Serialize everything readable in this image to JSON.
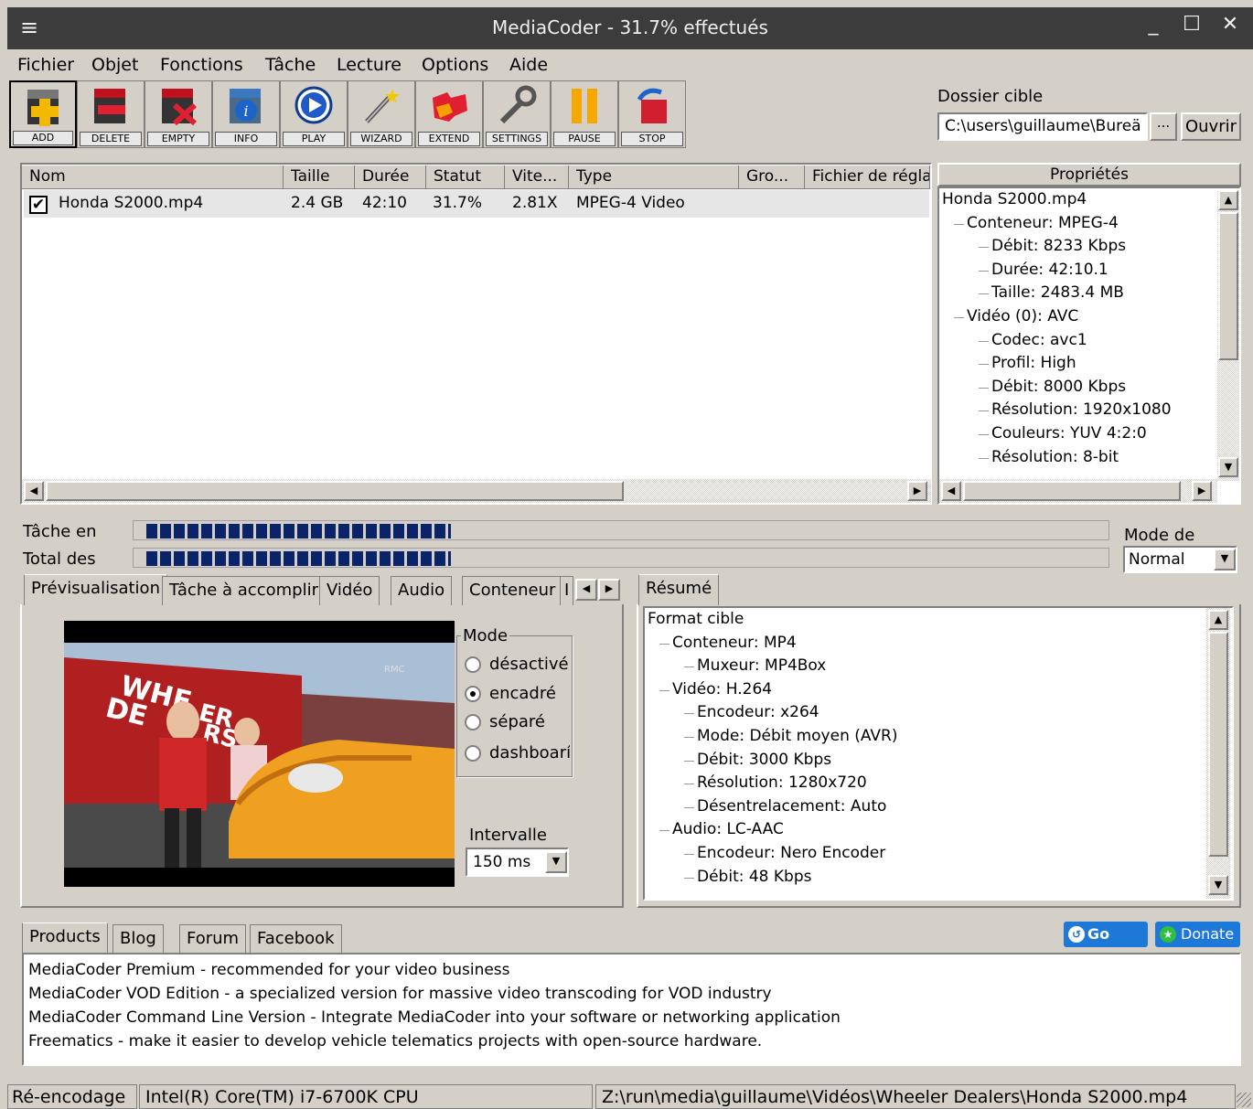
{
  "window": {
    "title": "MediaCoder - 31.7% effectués"
  },
  "menu": [
    "Fichier",
    "Objet",
    "Fonctions",
    "Tâche",
    "Lecture",
    "Options",
    "Aide"
  ],
  "toolbar": [
    {
      "label": "ADD",
      "icon": "add-icon"
    },
    {
      "label": "DELETE",
      "icon": "delete-icon"
    },
    {
      "label": "EMPTY",
      "icon": "empty-icon"
    },
    {
      "label": "INFO",
      "icon": "info-icon"
    },
    {
      "label": "PLAY",
      "icon": "play-icon"
    },
    {
      "label": "WIZARD",
      "icon": "wizard-icon"
    },
    {
      "label": "EXTEND",
      "icon": "extend-icon"
    },
    {
      "label": "SETTINGS",
      "icon": "settings-icon"
    },
    {
      "label": "PAUSE",
      "icon": "pause-icon"
    },
    {
      "label": "STOP",
      "icon": "stop-icon"
    }
  ],
  "target_folder": {
    "label": "Dossier cible",
    "value": "C:\\users\\guillaume\\Bureä",
    "browse": "...",
    "open": "Ouvrir"
  },
  "file_list": {
    "columns": [
      "Nom",
      "Taille",
      "Durée",
      "Statut",
      "Vite...",
      "Type",
      "Gro...",
      "Fichier de régla"
    ],
    "rows": [
      {
        "checked": true,
        "name": "Honda S2000.mp4",
        "size": "2.4 GB",
        "duration": "42:10",
        "status": "31.7%",
        "speed": "2.81X",
        "type": "MPEG-4 Video"
      }
    ]
  },
  "properties": {
    "header": "Propriétés",
    "items": [
      {
        "level": 0,
        "text": "Honda S2000.mp4"
      },
      {
        "level": 1,
        "text": "Conteneur: MPEG-4"
      },
      {
        "level": 2,
        "text": "Débit: 8233 Kbps"
      },
      {
        "level": 2,
        "text": "Durée: 42:10.1"
      },
      {
        "level": 2,
        "text": "Taille: 2483.4 MB"
      },
      {
        "level": 1,
        "text": "Vidéo (0): AVC"
      },
      {
        "level": 2,
        "text": "Codec: avc1"
      },
      {
        "level": 2,
        "text": "Profil: High"
      },
      {
        "level": 2,
        "text": "Débit: 8000 Kbps"
      },
      {
        "level": 2,
        "text": "Résolution: 1920x1080"
      },
      {
        "level": 2,
        "text": "Couleurs: YUV 4:2:0"
      },
      {
        "level": 2,
        "text": "Résolution: 8-bit"
      }
    ]
  },
  "progress": {
    "task_label": "Tâche en",
    "total_label": "Total des",
    "task_fraction": 0.317,
    "total_fraction": 0.317,
    "mode_label": "Mode de",
    "mode_value": "Normal"
  },
  "left_tabs": [
    "Prévisualisation",
    "Tâche à accomplir",
    "Vidéo",
    "Audio",
    "Conteneur",
    "I"
  ],
  "preview": {
    "mode_label": "Mode",
    "modes": [
      {
        "label": "désactivé",
        "selected": false
      },
      {
        "label": "encadré",
        "selected": true
      },
      {
        "label": "séparé",
        "selected": false
      },
      {
        "label": "dashboarí",
        "selected": false
      }
    ],
    "interval_label": "Intervalle",
    "interval_value": "150 ms",
    "sign_line1": "WHE",
    "sign_line2": "DE",
    "sign_line3": "ER",
    "sign_line4": "RS",
    "overlay_logo": "RMC"
  },
  "summary": {
    "tab": "Résumé",
    "items": [
      {
        "level": 0,
        "text": "Format cible"
      },
      {
        "level": 1,
        "text": "Conteneur: MP4"
      },
      {
        "level": 2,
        "text": "Muxeur: MP4Box"
      },
      {
        "level": 1,
        "text": "Vidéo: H.264"
      },
      {
        "level": 2,
        "text": "Encodeur: x264"
      },
      {
        "level": 2,
        "text": "Mode: Débit moyen (AVR)"
      },
      {
        "level": 2,
        "text": "Débit: 3000 Kbps"
      },
      {
        "level": 2,
        "text": "Résolution: 1280x720"
      },
      {
        "level": 2,
        "text": "Désentrelacement: Auto"
      },
      {
        "level": 1,
        "text": "Audio: LC-AAC"
      },
      {
        "level": 2,
        "text": "Encodeur: Nero Encoder"
      },
      {
        "level": 2,
        "text": "Débit: 48 Kbps"
      }
    ]
  },
  "bottom_tabs": [
    "Products",
    "Blog",
    "Forum",
    "Facebook"
  ],
  "buttons": {
    "gopro": "Go PRO",
    "donate": "Donate"
  },
  "products": [
    "MediaCoder Premium - recommended for your video business",
    "MediaCoder VOD Edition - a specialized version for massive video transcoding for VOD industry",
    "MediaCoder Command Line Version - Integrate MediaCoder into your software or networking application",
    "Freematics - make it easier to develop vehicle telematics projects with open-source hardware."
  ],
  "status": {
    "mode": "Ré-encodage",
    "cpu": "Intel(R) Core(TM) i7-6700K CPU",
    "path": "Z:\\run\\media\\guillaume\\Vidéos\\Wheeler Dealers\\Honda S2000.mp4"
  },
  "colors": {
    "titlebar": "#3c3c3c",
    "progress": "#0a246a",
    "window_bg": "#d4d0c8"
  }
}
